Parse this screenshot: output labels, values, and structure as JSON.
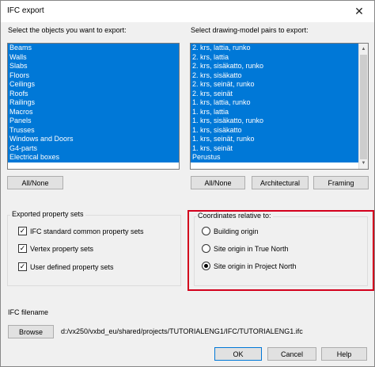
{
  "window": {
    "title": "IFC export",
    "close_glyph": "✕"
  },
  "objects": {
    "label": "Select the objects you want to export:",
    "items": [
      "Beams",
      "Walls",
      "Slabs",
      "Floors",
      "Ceilings",
      "Roofs",
      "Railings",
      "Macros",
      "Panels",
      "Trusses",
      "Windows and Doors",
      "G4-parts",
      "Electrical boxes"
    ],
    "all_none_label": "All/None"
  },
  "pairs": {
    "label": "Select drawing-model pairs to export:",
    "items": [
      "2. krs, lattia, runko",
      "2. krs, lattia",
      "2. krs, sisäkatto, runko",
      "2. krs, sisäkatto",
      "2. krs, seinät, runko",
      "2. krs, seinät",
      "1. krs, lattia, runko",
      "1. krs, lattia",
      "1. krs, sisäkatto, runko",
      "1. krs, sisäkatto",
      "1. krs, seinät, runko",
      "1. krs, seinät",
      "Perustus"
    ],
    "all_none_label": "All/None",
    "architectural_label": "Architectural",
    "framing_label": "Framing"
  },
  "property_sets": {
    "title": "Exported property sets",
    "options": [
      {
        "label": "IFC standard common property sets",
        "checked": true
      },
      {
        "label": "Vertex property sets",
        "checked": true
      },
      {
        "label": "User defined property sets",
        "checked": true
      }
    ],
    "check_glyph": "✓"
  },
  "coordinates": {
    "title": "Coordinates relative to:",
    "options": [
      {
        "label": "Building origin",
        "selected": false
      },
      {
        "label": "Site origin in True North",
        "selected": false
      },
      {
        "label": "Site origin in Project North",
        "selected": true
      }
    ]
  },
  "filename": {
    "label": "IFC filename",
    "browse_label": "Browse",
    "path": "d:/vx250/vxbd_eu/shared/projects/TUTORIALENG1/IFC/TUTORIALENG1.ifc"
  },
  "actions": {
    "ok_label": "OK",
    "cancel_label": "Cancel",
    "help_label": "Help"
  },
  "colors": {
    "selection": "#0078d7",
    "highlight": "#d3001c"
  },
  "icons": {
    "scroll_up": "▲",
    "scroll_down": "▼"
  }
}
